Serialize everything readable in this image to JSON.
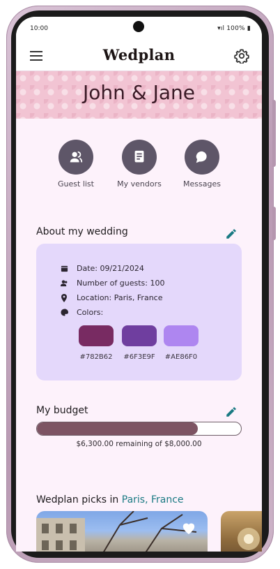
{
  "status": {
    "time": "10:00",
    "battery": "100%"
  },
  "app": {
    "logo": "Wedplan"
  },
  "banner": {
    "couple": "John & Jane"
  },
  "quick_actions": [
    {
      "label": "Guest list",
      "icon": "guests-icon"
    },
    {
      "label": "My vendors",
      "icon": "vendors-icon"
    },
    {
      "label": "Messages",
      "icon": "messages-icon"
    }
  ],
  "about": {
    "title": "About my wedding",
    "date": "Date: 09/21/2024",
    "guests": "Number of guests: 100",
    "location": "Location: Paris, France",
    "colors_label": "Colors:",
    "colors": [
      {
        "hex": "#782B62",
        "label": "#782B62"
      },
      {
        "hex": "#6F3E9F",
        "label": "#6F3E9F"
      },
      {
        "hex": "#AE86F0",
        "label": "#AE86F0"
      }
    ]
  },
  "budget": {
    "title": "My budget",
    "total": 8000,
    "remaining": 6300,
    "spent_fraction": 0.7875,
    "text": "$6,300.00 remaining of $8,000.00"
  },
  "picks": {
    "title_prefix": "Wedplan picks in ",
    "location": "Paris, France"
  },
  "colors": {
    "accent": "#1A7A83",
    "icon_circle": "#5E5668",
    "card": "#E4D8FB",
    "budget_fill": "#7D5463"
  }
}
